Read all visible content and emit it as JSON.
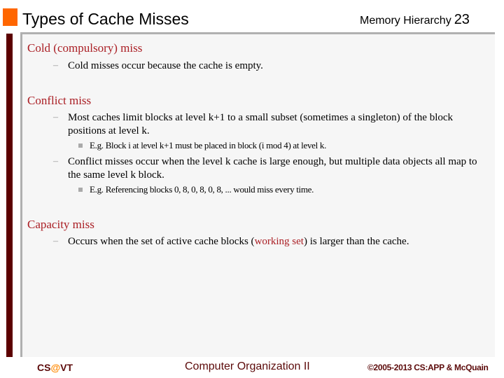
{
  "header": {
    "title": "Types of Cache Misses",
    "section": "Memory Hierarchy",
    "slide_number": "23"
  },
  "colors": {
    "accent_orange": "#ff6600",
    "maroon": "#5c0000",
    "heading_red": "#aa1e24"
  },
  "content": {
    "cold": {
      "heading": "Cold (compulsory) miss",
      "items": [
        {
          "text": "Cold misses occur because the cache is empty."
        }
      ]
    },
    "conflict": {
      "heading": "Conflict miss",
      "items": [
        {
          "text": "Most caches limit blocks at level k+1 to a small subset (sometimes a singleton) of the block positions at level k.",
          "sub": "E.g. Block i at level k+1 must be placed in block (i mod 4) at level k."
        },
        {
          "text": "Conflict misses occur when the level k cache is large enough, but multiple data objects all map to the same level k block.",
          "sub": "E.g. Referencing blocks 0, 8, 0, 8, 0, 8, ... would miss every time."
        }
      ]
    },
    "capacity": {
      "heading": "Capacity miss",
      "items": [
        {
          "text_before": "Occurs when the set of active cache blocks (",
          "highlight": "working set",
          "text_after": ") is larger than the cache."
        }
      ]
    }
  },
  "footer": {
    "left_prefix": "CS",
    "left_at": "@",
    "left_suffix": "VT",
    "center": "Computer Organization II",
    "right": "©2005-2013 CS:APP & McQuain"
  }
}
